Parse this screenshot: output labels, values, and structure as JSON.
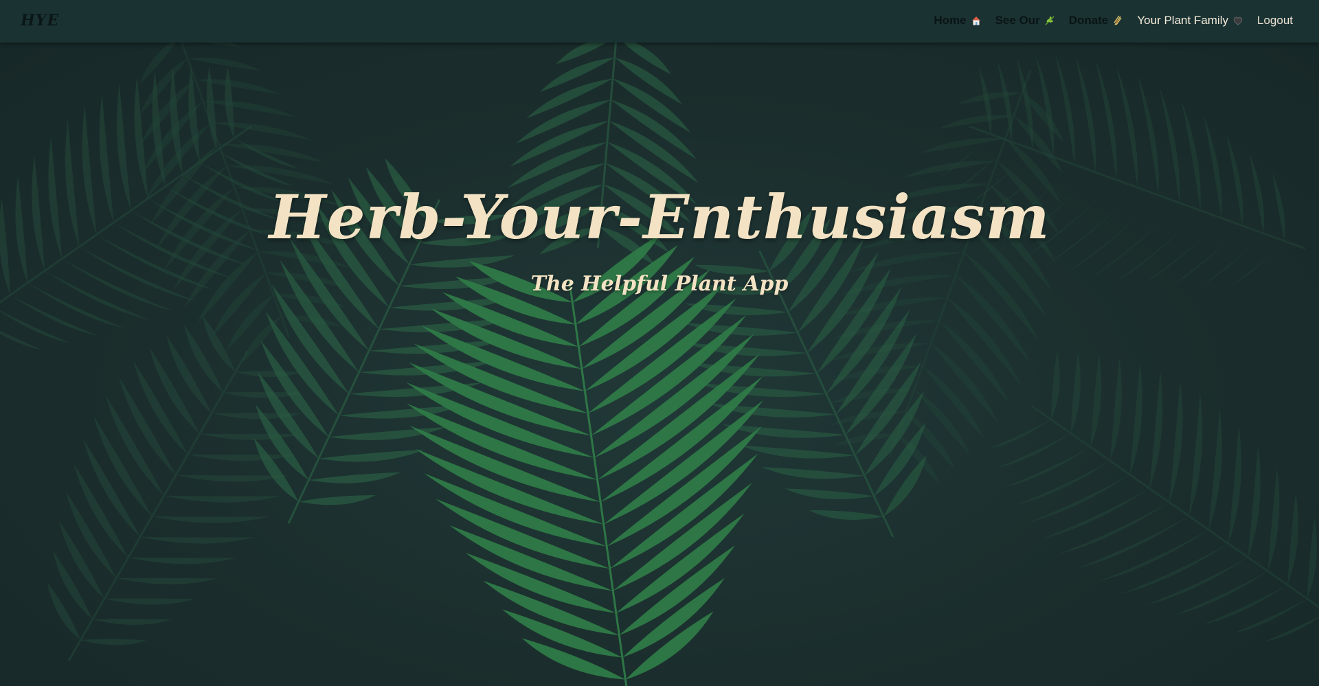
{
  "navbar": {
    "brand": "HYE",
    "links": [
      {
        "label": "Home",
        "icon": "house-icon"
      },
      {
        "label": "See Our",
        "icon": "herb-icon"
      },
      {
        "label": "Donate",
        "icon": "sheaf-icon"
      },
      {
        "label": "Your Plant Family",
        "icon": "heart-icon"
      },
      {
        "label": "Logout"
      }
    ]
  },
  "hero": {
    "title": "Herb-Your-Enthusiasm",
    "subtitle": "The Helpful Plant App"
  },
  "colors": {
    "navbar_bg": "#1b3233",
    "hero_text": "#f3e3c4",
    "leaf": "#2f7a47"
  }
}
